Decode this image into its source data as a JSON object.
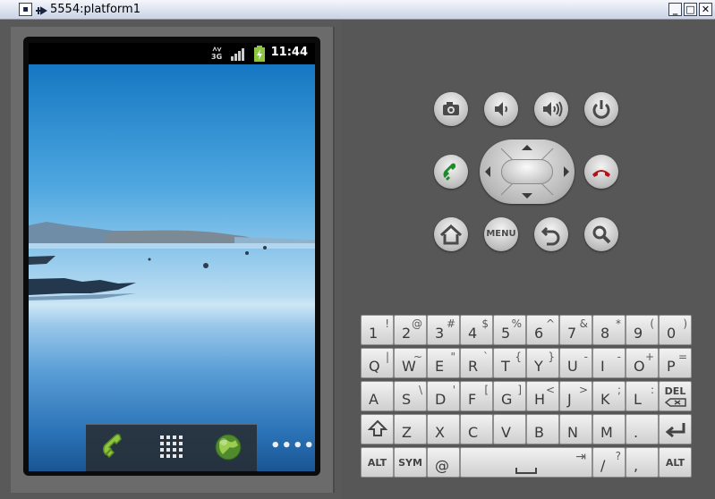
{
  "window": {
    "title": "5554:platform1",
    "minimize": "_",
    "maximize": "□",
    "close": "✕"
  },
  "status_bar": {
    "network": "3G",
    "time": "11:44"
  },
  "dock": {
    "phone_icon": "phone-icon",
    "apps_icon": "apps-grid-icon",
    "browser_icon": "globe-icon",
    "more_label": "••••"
  },
  "hw_buttons": [
    {
      "name": "camera-button",
      "icon": "camera-icon"
    },
    {
      "name": "volume-down-button",
      "icon": "volume-down-icon"
    },
    {
      "name": "volume-up-button",
      "icon": "volume-up-icon"
    },
    {
      "name": "power-button",
      "icon": "power-icon"
    },
    {
      "name": "call-button",
      "icon": "call-icon"
    },
    {
      "name": "end-call-button",
      "icon": "end-call-icon"
    },
    {
      "name": "home-button",
      "icon": "home-icon"
    },
    {
      "name": "menu-button",
      "label": "MENU"
    },
    {
      "name": "back-button",
      "icon": "back-icon"
    },
    {
      "name": "search-button",
      "icon": "search-icon"
    }
  ],
  "keyboard": {
    "row1": [
      {
        "main": "1",
        "alt": "!"
      },
      {
        "main": "2",
        "alt": "@"
      },
      {
        "main": "3",
        "alt": "#"
      },
      {
        "main": "4",
        "alt": "$"
      },
      {
        "main": "5",
        "alt": "%"
      },
      {
        "main": "6",
        "alt": "^"
      },
      {
        "main": "7",
        "alt": "&"
      },
      {
        "main": "8",
        "alt": "*"
      },
      {
        "main": "9",
        "alt": "("
      },
      {
        "main": "0",
        "alt": ")"
      }
    ],
    "row2": [
      {
        "main": "Q",
        "alt": "|"
      },
      {
        "main": "W",
        "alt": "~"
      },
      {
        "main": "E",
        "alt": "\""
      },
      {
        "main": "R",
        "alt": "`"
      },
      {
        "main": "T",
        "alt": "{"
      },
      {
        "main": "Y",
        "alt": "}"
      },
      {
        "main": "U",
        "alt": "-"
      },
      {
        "main": "I",
        "alt": "-"
      },
      {
        "main": "O",
        "alt": "+"
      },
      {
        "main": "P",
        "alt": "="
      }
    ],
    "row3": [
      {
        "main": "A",
        "alt": ""
      },
      {
        "main": "S",
        "alt": "\\"
      },
      {
        "main": "D",
        "alt": "'"
      },
      {
        "main": "F",
        "alt": "["
      },
      {
        "main": "G",
        "alt": "]"
      },
      {
        "main": "H",
        "alt": "<"
      },
      {
        "main": "J",
        "alt": ">"
      },
      {
        "main": "K",
        "alt": ";"
      },
      {
        "main": "L",
        "alt": ":"
      },
      {
        "main": "DEL",
        "alt": ""
      }
    ],
    "row4": [
      {
        "main": "⇧",
        "alt": ""
      },
      {
        "main": "Z",
        "alt": ""
      },
      {
        "main": "X",
        "alt": ""
      },
      {
        "main": "C",
        "alt": ""
      },
      {
        "main": "V",
        "alt": ""
      },
      {
        "main": "B",
        "alt": ""
      },
      {
        "main": "N",
        "alt": ""
      },
      {
        "main": "M",
        "alt": ""
      },
      {
        "main": ".",
        "alt": ""
      },
      {
        "main": "↵",
        "alt": ""
      }
    ],
    "row5": {
      "alt_left": "ALT",
      "sym": "SYM",
      "at": "@",
      "space_arrow": "⇥",
      "slash": "/",
      "question": "?",
      "comma": ",",
      "alt_right": "ALT"
    }
  },
  "colors": {
    "call_green": "#1f8a2c",
    "end_call_red": "#b3141a",
    "wallpaper_sky": "#1577c2"
  }
}
